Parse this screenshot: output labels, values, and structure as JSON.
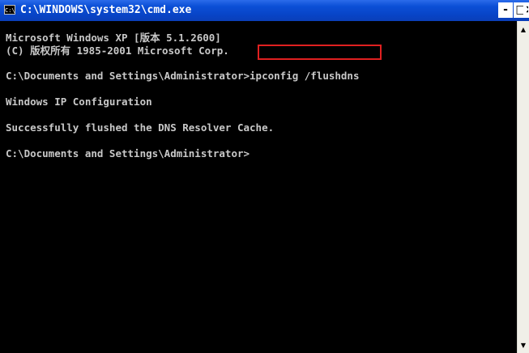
{
  "window": {
    "title": "C:\\WINDOWS\\system32\\cmd.exe",
    "icon_label": "C:\\",
    "controls": {
      "minimize_label": "-",
      "maximize_label": "□",
      "close_label": "×"
    }
  },
  "console": {
    "lines": [
      "Microsoft Windows XP [版本 5.1.2600]",
      "(C) 版权所有 1985-2001 Microsoft Corp.",
      "",
      "C:\\Documents and Settings\\Administrator>ipconfig /flushdns",
      "",
      "Windows IP Configuration",
      "",
      "Successfully flushed the DNS Resolver Cache.",
      "",
      "C:\\Documents and Settings\\Administrator>"
    ]
  },
  "colors": {
    "console_background": "#000000",
    "console_text": "#c8c8c8",
    "titlebar": "#0a4bd0",
    "highlight_box": "#e02020"
  },
  "scrollbar": {
    "up_arrow": "▲",
    "down_arrow": "▼"
  }
}
